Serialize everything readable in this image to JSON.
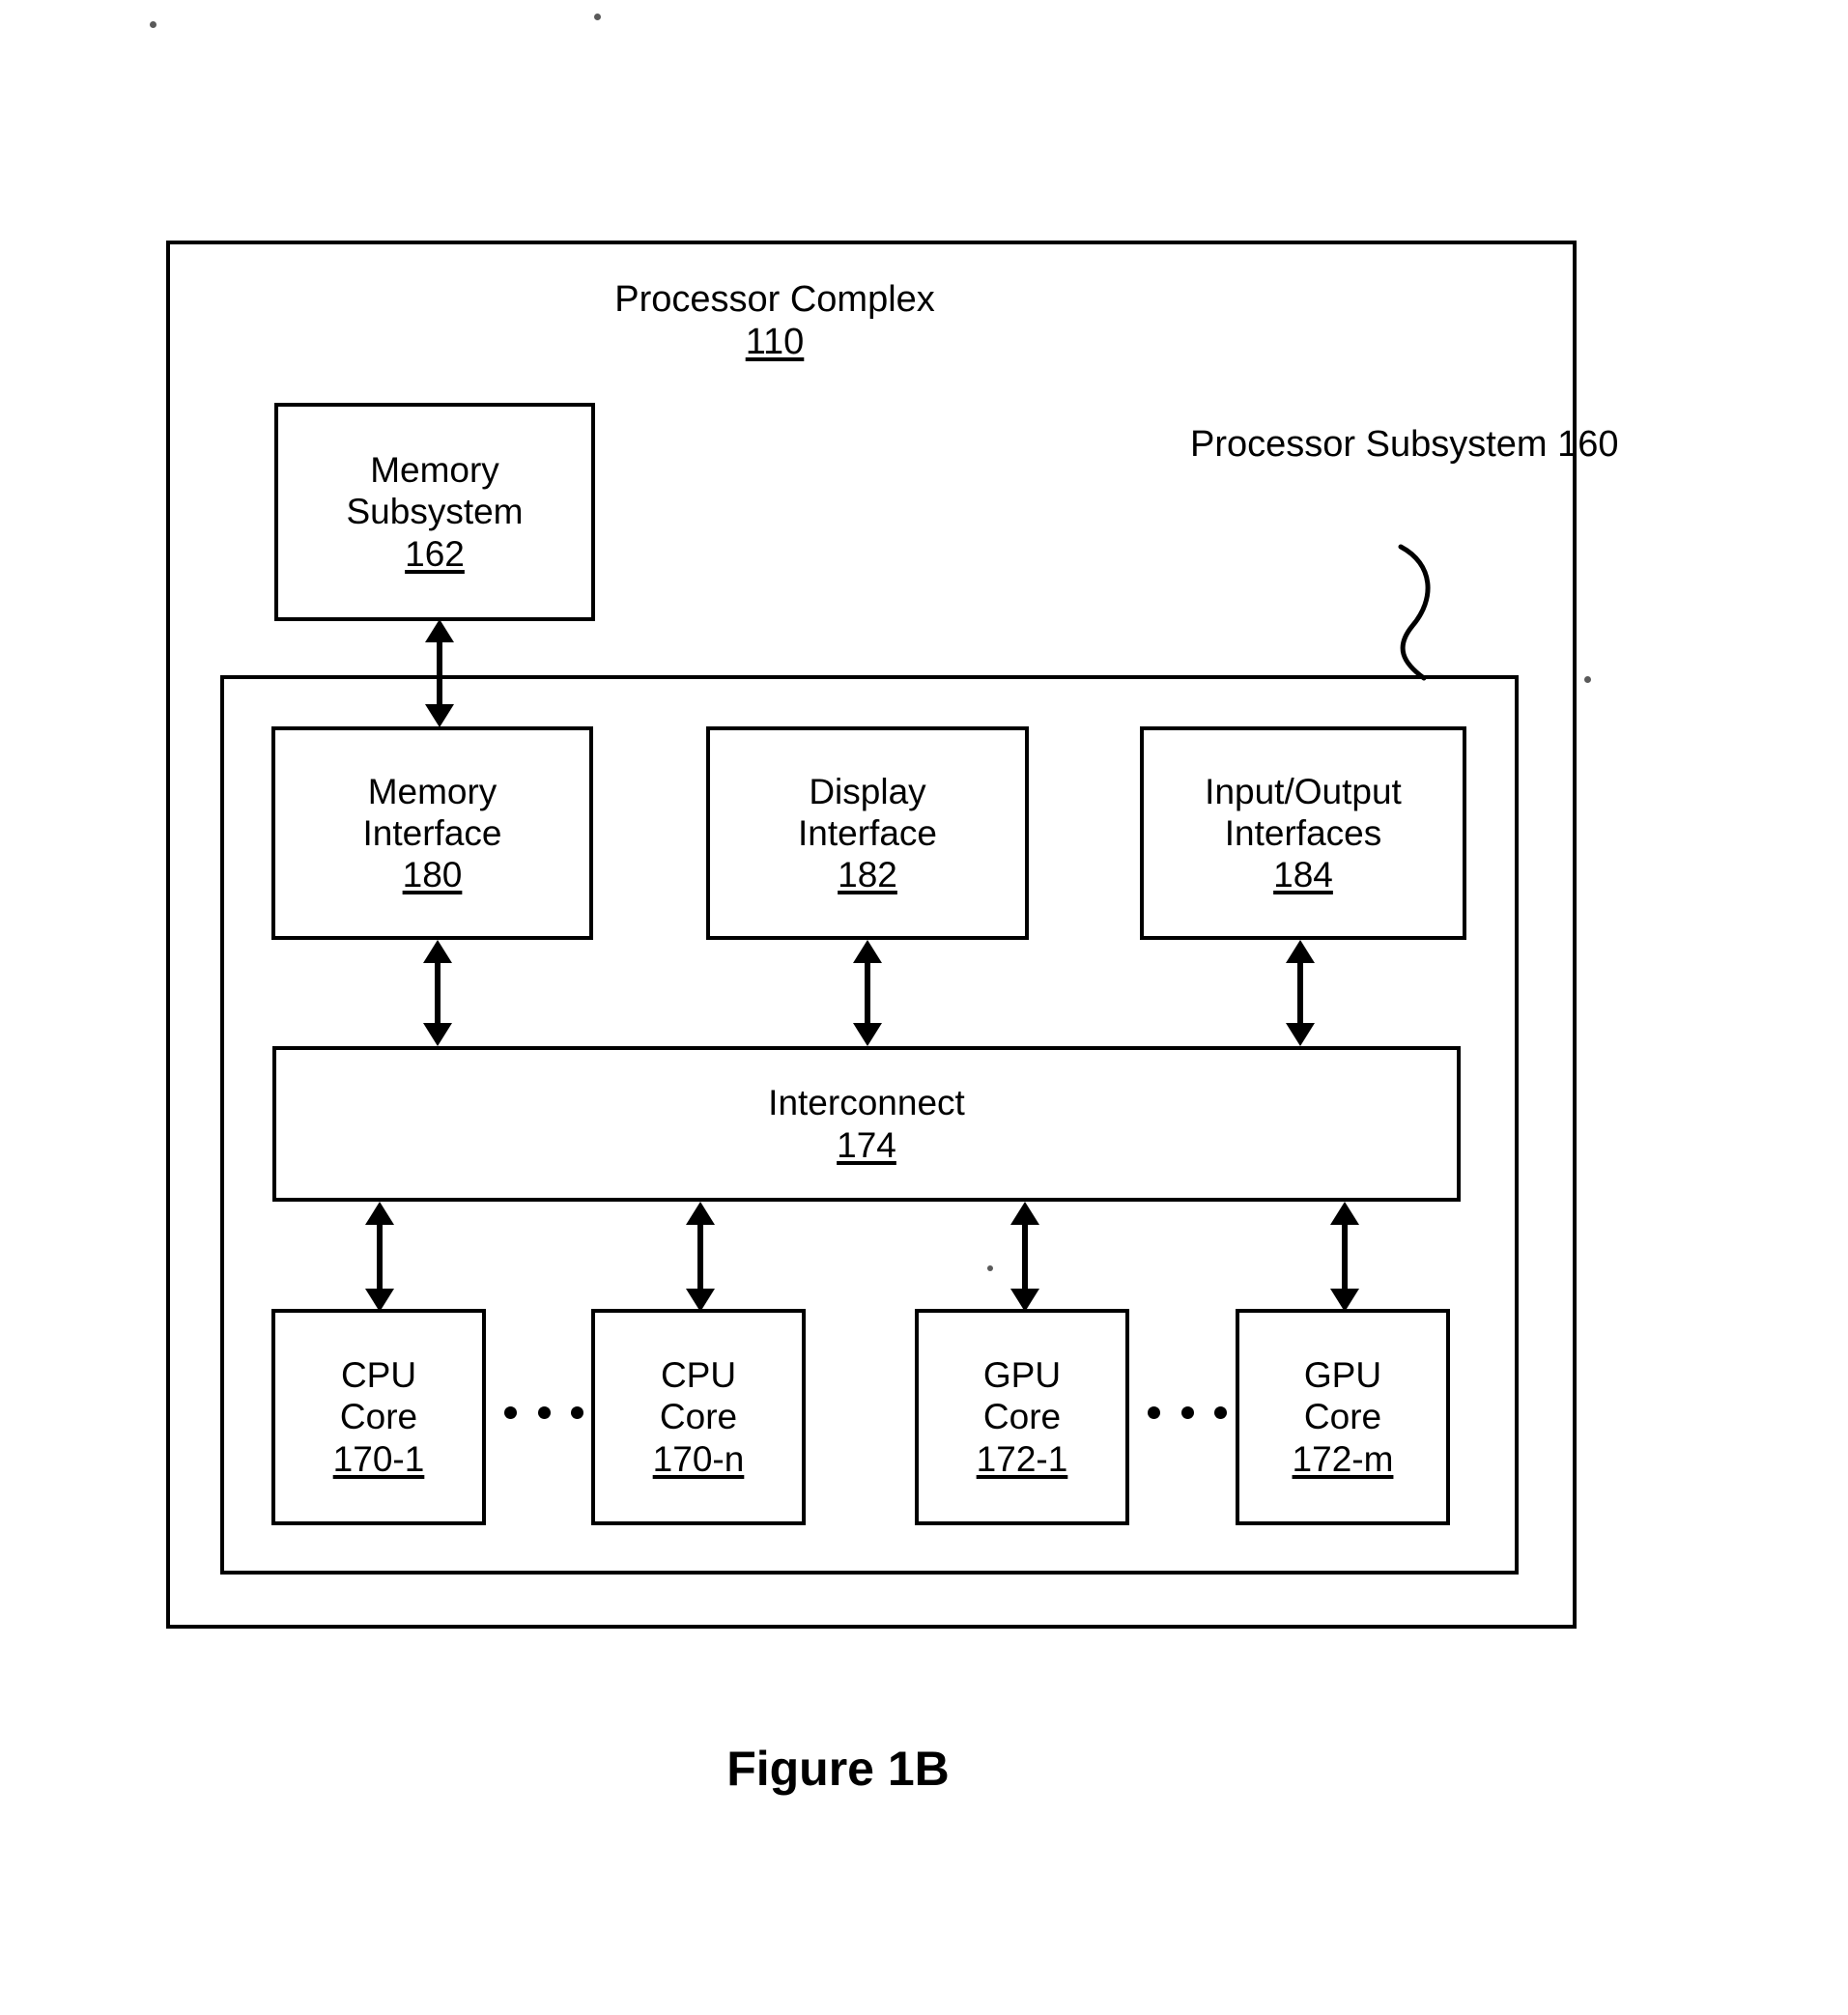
{
  "figure": {
    "caption": "Figure 1B"
  },
  "diagram": {
    "outer_block": {
      "title": "Processor Complex",
      "ref": "110"
    },
    "subsystem_label": {
      "line1": "Processor",
      "line2": "Subsystem",
      "ref": "160"
    },
    "blocks": [
      {
        "id": "memory-subsystem",
        "line1": "Memory",
        "line2": "Subsystem",
        "ref": "162"
      },
      {
        "id": "memory-interface",
        "line1": "Memory",
        "line2": "Interface",
        "ref": "180"
      },
      {
        "id": "display-interface",
        "line1": "Display",
        "line2": "Interface",
        "ref": "182"
      },
      {
        "id": "input-output-interfaces",
        "line1": "Input/Output",
        "line2": "Interfaces",
        "ref": "184"
      },
      {
        "id": "interconnect",
        "line1": "Interconnect",
        "line2": "",
        "ref": "174"
      },
      {
        "id": "cpu-core-first",
        "line1": "CPU",
        "line2": "Core",
        "ref": "170-1"
      },
      {
        "id": "cpu-core-last",
        "line1": "CPU",
        "line2": "Core",
        "ref": "170-n"
      },
      {
        "id": "gpu-core-first",
        "line1": "GPU",
        "line2": "Core",
        "ref": "172-1"
      },
      {
        "id": "gpu-core-last",
        "line1": "GPU",
        "line2": "Core",
        "ref": "172-m"
      }
    ],
    "connectors": [
      {
        "id": "memory-subsystem-to-memory-interface",
        "kind": "double-arrow-vertical"
      },
      {
        "id": "memory-interface-to-interconnect",
        "kind": "double-arrow-vertical"
      },
      {
        "id": "display-interface-to-interconnect",
        "kind": "double-arrow-vertical"
      },
      {
        "id": "io-interfaces-to-interconnect",
        "kind": "double-arrow-vertical"
      },
      {
        "id": "interconnect-to-cpu-core-first",
        "kind": "double-arrow-vertical"
      },
      {
        "id": "interconnect-to-cpu-core-last",
        "kind": "double-arrow-vertical"
      },
      {
        "id": "interconnect-to-gpu-core-first",
        "kind": "double-arrow-vertical"
      },
      {
        "id": "interconnect-to-gpu-core-last",
        "kind": "double-arrow-vertical"
      }
    ],
    "ellipses": [
      {
        "id": "cpu-core-ellipsis",
        "dots": 3
      },
      {
        "id": "gpu-core-ellipsis",
        "dots": 3
      }
    ],
    "colors": {
      "ink": "#000000",
      "paper": "#ffffff"
    }
  }
}
